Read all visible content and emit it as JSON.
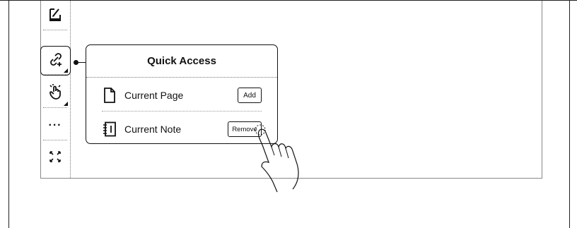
{
  "popup": {
    "title": "Quick Access",
    "rows": [
      {
        "label": "Current Page",
        "button": "Add",
        "icon": "page-icon"
      },
      {
        "label": "Current Note",
        "button": "Remove",
        "icon": "notebook-icon"
      }
    ]
  },
  "toolbar": {
    "tools": [
      {
        "icon": "edit-icon",
        "active": false
      },
      {
        "icon": "link-add-icon",
        "active": true
      },
      {
        "icon": "touch-gesture-icon",
        "active": false
      },
      {
        "icon": "more-icon",
        "label": "···"
      },
      {
        "icon": "expand-icon"
      }
    ]
  },
  "colors": {
    "stroke": "#111111",
    "separator": "#888888",
    "background": "#ffffff"
  }
}
